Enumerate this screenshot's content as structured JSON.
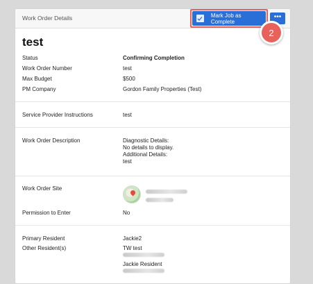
{
  "header": {
    "title": "Work Order Details",
    "complete_button_label": "Mark Job as Complete",
    "more_button_label": "•••",
    "step_badge": "2"
  },
  "work_order": {
    "title": "test",
    "fields": [
      {
        "label": "Status",
        "value": "Confirming Completion"
      },
      {
        "label": "Work Order Number",
        "value": "test"
      },
      {
        "label": "Max Budget",
        "value": "$500"
      },
      {
        "label": "PM Company",
        "value": "Gordon Family Properties (Test)"
      }
    ],
    "instructions": {
      "label": "Service Provider Instructions",
      "value": "test"
    },
    "description": {
      "label": "Work Order Description",
      "lines": [
        "Diagnostic Details:",
        "No details to display.",
        "Additional Details:",
        "test"
      ]
    },
    "site": {
      "label": "Work Order Site"
    },
    "permission": {
      "label": "Permission to Enter",
      "value": "No"
    },
    "primary_resident": {
      "label": "Primary Resident",
      "value": "Jackie2"
    },
    "other_residents": {
      "label": "Other Resident(s)",
      "names": [
        "TW test",
        "Jackie Resident"
      ]
    }
  },
  "colors": {
    "primary_button": "#2a6fd8",
    "highlight": "#e8615a"
  },
  "icons": {
    "complete_button_icon": "checkbox-icon",
    "site_icon": "map-pin-icon"
  }
}
